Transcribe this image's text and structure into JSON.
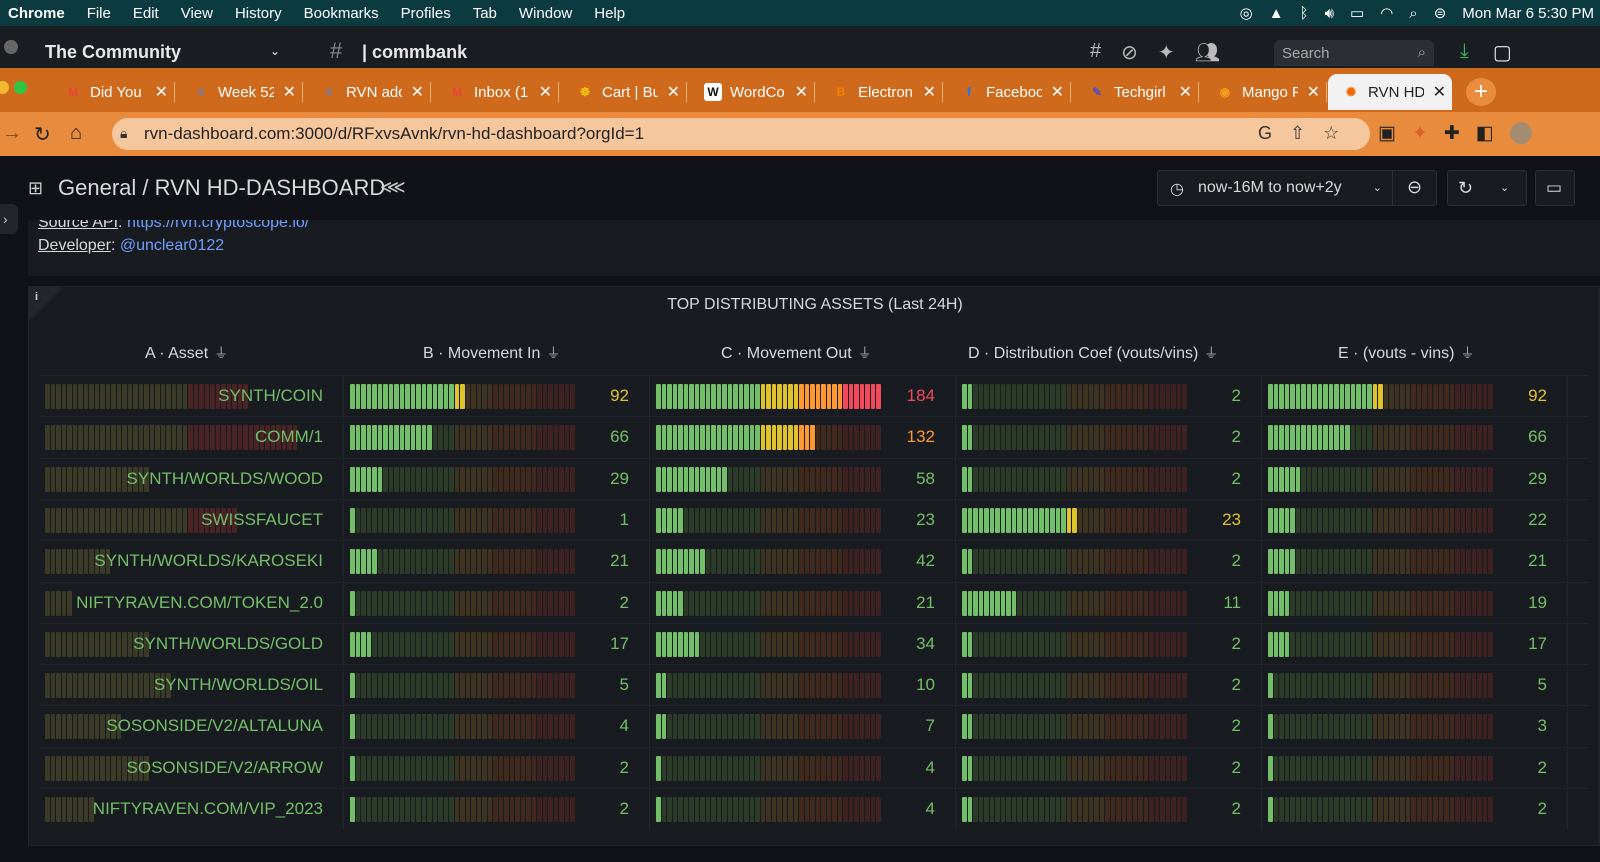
{
  "menubar": {
    "app": "Chrome",
    "items": [
      "File",
      "Edit",
      "View",
      "History",
      "Bookmarks",
      "Profiles",
      "Tab",
      "Window",
      "Help"
    ],
    "clock": "Mon Mar 6  5:30 PM"
  },
  "slack": {
    "workspace": "The Community",
    "channel": "commbank",
    "search_placeholder": "Search"
  },
  "tabs": [
    {
      "label": "Did You",
      "icon": "gmail-icon",
      "color": "#ea4335",
      "glyph": "M"
    },
    {
      "label": "Week 52",
      "icon": "docs-icon",
      "color": "#4285f4",
      "glyph": "≡"
    },
    {
      "label": "RVN add",
      "icon": "docs-icon",
      "color": "#4285f4",
      "glyph": "≡"
    },
    {
      "label": "Inbox (1",
      "icon": "gmail-icon",
      "color": "#ea4335",
      "glyph": "M"
    },
    {
      "label": "Cart | Bu",
      "icon": "cart-icon",
      "color": "#f4c20d",
      "glyph": "☸"
    },
    {
      "label": "WordCo",
      "icon": "wordcounter-icon",
      "color": "#111111",
      "glyph": "W"
    },
    {
      "label": "Electron",
      "icon": "blogger-icon",
      "color": "#f57d00",
      "glyph": "B"
    },
    {
      "label": "Faceboo",
      "icon": "facebook-icon",
      "color": "#1877f2",
      "glyph": "f"
    },
    {
      "label": "Techgirl",
      "icon": "techgirl-icon",
      "color": "#5b4bc4",
      "glyph": "✎"
    },
    {
      "label": "Mango F",
      "icon": "mango-icon",
      "color": "#f0a020",
      "glyph": "◉"
    },
    {
      "label": "RVN HD",
      "icon": "grafana-icon",
      "color": "#f46800",
      "glyph": "✺",
      "active": true
    }
  ],
  "address": {
    "url": "rvn-dashboard.com:3000/d/RFxvsAvnk/rvn-hd-dashboard?orgId=1"
  },
  "dashboard": {
    "breadcrumb": "General / RVN HD-DASHBOARD",
    "time_range": "now-16M to now+2y"
  },
  "info": {
    "source_label": "Source API",
    "source_link": "https://rvn.cryptoscope.io/",
    "dev_label": "Developer",
    "dev_link": "@unclear0122"
  },
  "panel": {
    "title": "TOP DISTRIBUTING ASSETS (Last 24H)",
    "columns": [
      "A · Asset",
      "B · Movement In",
      "C · Movement Out",
      "D · Distribution Coef (vouts/vins)",
      "E · (vouts - vins)"
    ],
    "rows": [
      {
        "asset": "SYNTH/COIN",
        "in": 92,
        "out": 184,
        "coef": 2,
        "diff": 92
      },
      {
        "asset": "COMM/1",
        "in": 66,
        "out": 132,
        "coef": 2,
        "diff": 66
      },
      {
        "asset": "SYNTH/WORLDS/WOOD",
        "in": 29,
        "out": 58,
        "coef": 2,
        "diff": 29
      },
      {
        "asset": "SWISSFAUCET",
        "in": 1,
        "out": 23,
        "coef": 23,
        "diff": 22
      },
      {
        "asset": "SYNTH/WORLDS/KAROSEKI",
        "in": 21,
        "out": 42,
        "coef": 2,
        "diff": 21
      },
      {
        "asset": "NIFTYRAVEN.COM/TOKEN_2.0",
        "in": 2,
        "out": 21,
        "coef": 11,
        "diff": 19
      },
      {
        "asset": "SYNTH/WORLDS/GOLD",
        "in": 17,
        "out": 34,
        "coef": 2,
        "diff": 17
      },
      {
        "asset": "SYNTH/WORLDS/OIL",
        "in": 5,
        "out": 10,
        "coef": 2,
        "diff": 5
      },
      {
        "asset": "SOSONSIDE/V2/ALTALUNA",
        "in": 4,
        "out": 7,
        "coef": 2,
        "diff": 3
      },
      {
        "asset": "SOSONSIDE/V2/ARROW",
        "in": 2,
        "out": 4,
        "coef": 2,
        "diff": 2
      },
      {
        "asset": "NIFTYRAVEN.COM/VIP_2023",
        "in": 2,
        "out": 4,
        "coef": 2,
        "diff": 2
      }
    ],
    "colors": {
      "green": "#73bf69",
      "yellow": "#e0c32a",
      "orange": "#ff9830",
      "red": "#f2495c",
      "dim": "#4a2a22"
    }
  }
}
